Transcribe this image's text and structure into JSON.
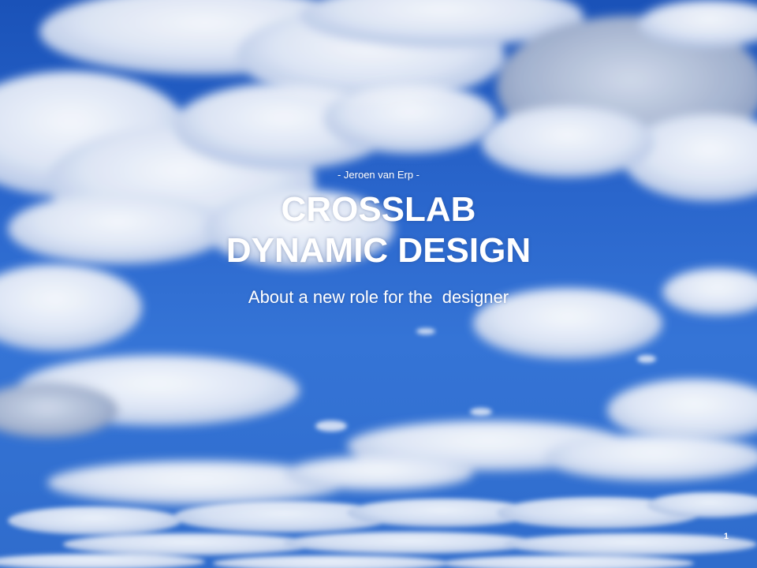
{
  "slide": {
    "byline": "- Jeroen van Erp -",
    "title_line_1": "CROSSLAB",
    "title_line_2": "DYNAMIC DESIGN",
    "subtitle": "About a new role for the  designer",
    "page_number": "1"
  },
  "background": {
    "sky_color": "#2a66cc",
    "cloud_color": "#f2f5fb",
    "cloud_shadow_color": "#9fb2d6"
  }
}
